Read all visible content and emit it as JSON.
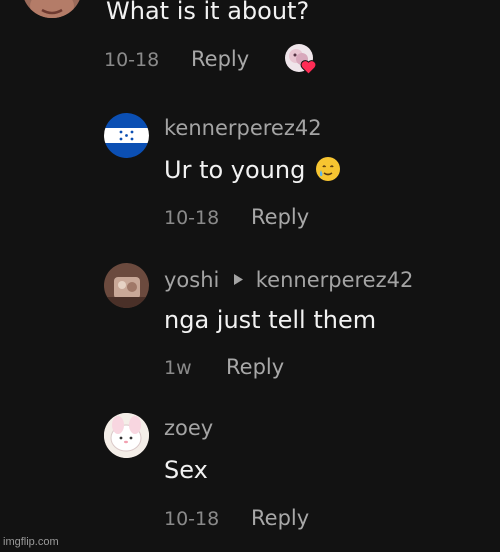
{
  "comments": [
    {
      "text": "What is it about?",
      "date": "10-18",
      "reply_label": "Reply"
    },
    {
      "username": "kennerperez42",
      "text": "Ur to young",
      "emoji": "🥲",
      "date": "10-18",
      "reply_label": "Reply"
    },
    {
      "username": "yoshi",
      "reply_to": "kennerperez42",
      "text": "nga just tell them",
      "date": "1w",
      "reply_label": "Reply"
    },
    {
      "username": "zoey",
      "text": "Sex",
      "date": "10-18",
      "reply_label": "Reply"
    }
  ],
  "icons": {
    "creator_liked": "creator-liked-heart-icon",
    "reply_arrow": "reply-to-arrow-icon"
  },
  "colors": {
    "background": "#121212",
    "heart": "#fe2c55",
    "flag_blue": "#0b4fb3"
  },
  "watermark": "imgflip.com"
}
